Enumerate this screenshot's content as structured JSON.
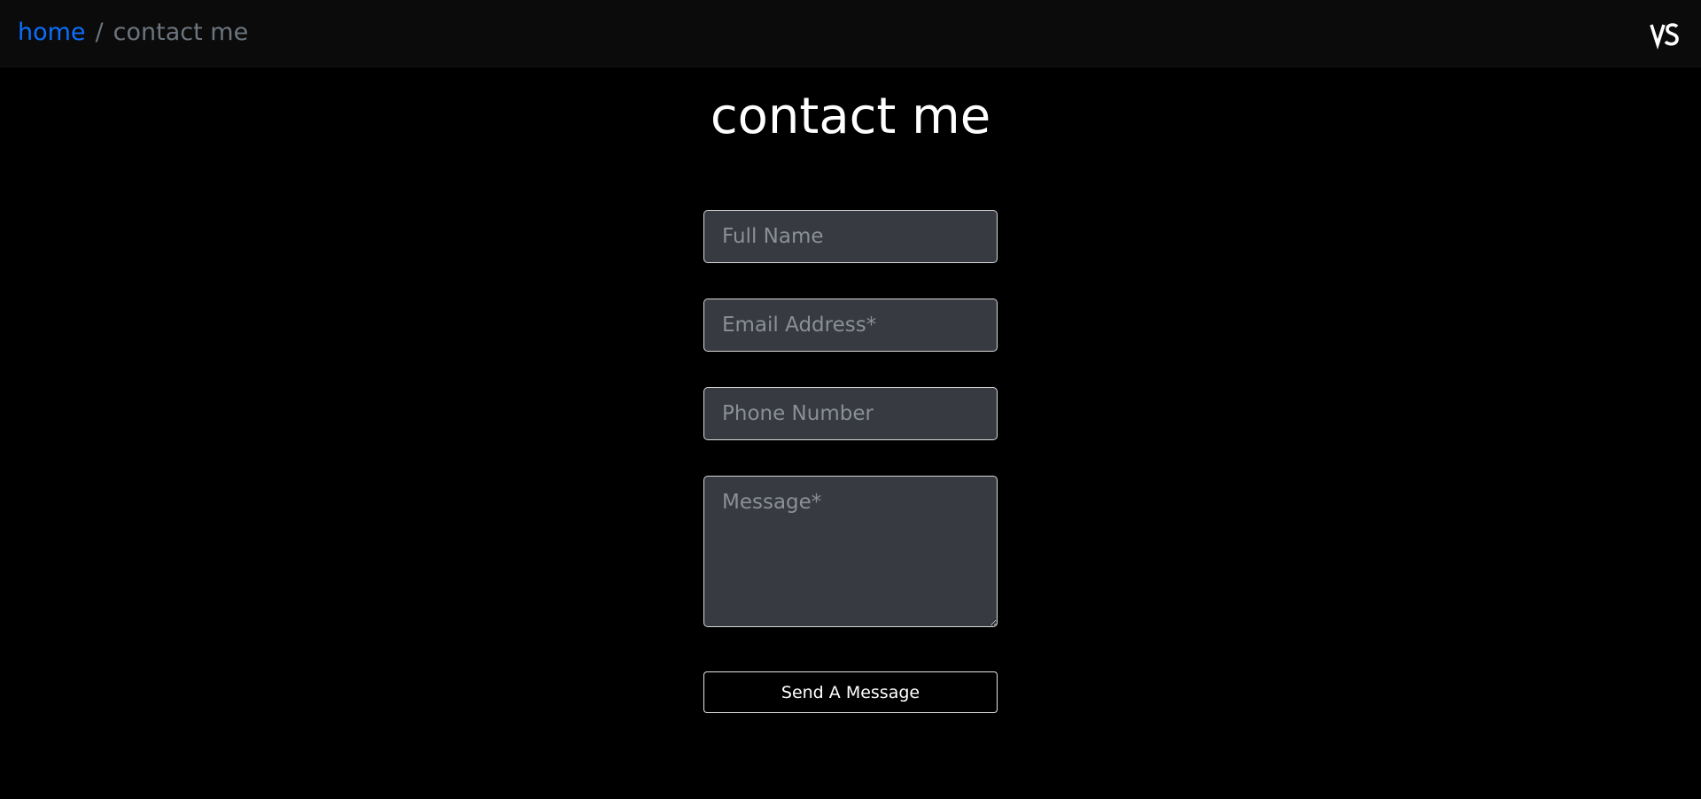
{
  "breadcrumb": {
    "home_label": "home",
    "separator": "/",
    "current_label": "contact me"
  },
  "logo": {
    "icon": "vs-logo-icon",
    "text": "VS"
  },
  "page": {
    "title": "contact me"
  },
  "form": {
    "full_name": {
      "placeholder": "Full Name",
      "value": ""
    },
    "email": {
      "placeholder": "Email Address*",
      "value": ""
    },
    "phone": {
      "placeholder": "Phone Number",
      "value": ""
    },
    "message": {
      "placeholder": "Message*",
      "value": ""
    },
    "submit_label": "Send A Message"
  },
  "colors": {
    "background": "#000000",
    "topbar": "#0b0b0b",
    "link": "#0d6efd",
    "muted": "#6c757d",
    "field_bg": "#373a40",
    "text": "#ffffff"
  }
}
